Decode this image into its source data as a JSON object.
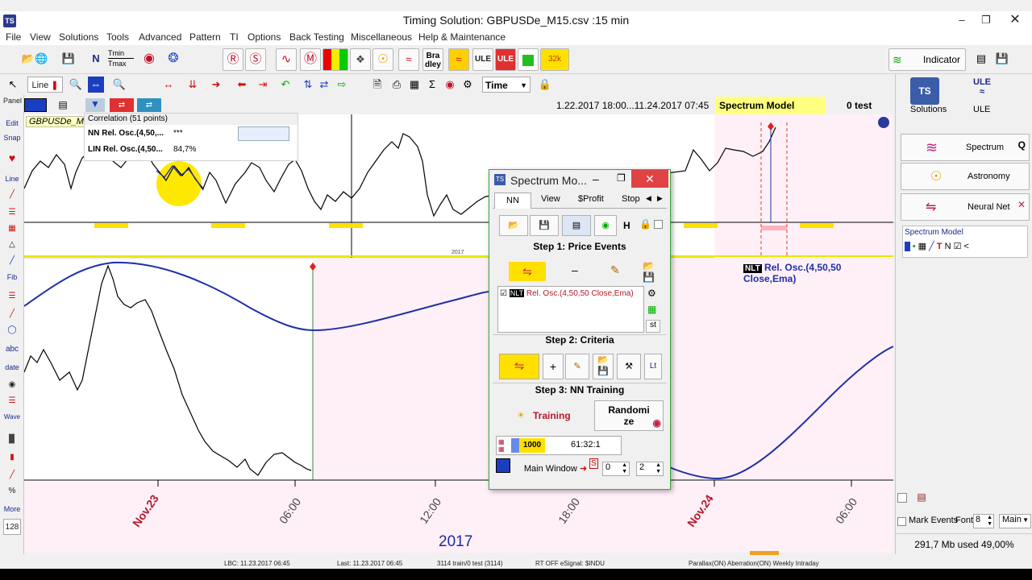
{
  "window": {
    "title": "Timing Solution:  GBPUSDe_M15.csv  :15 min",
    "app_icon": "TS"
  },
  "menu": [
    "File",
    "View",
    "Solutions",
    "Tools",
    "Advanced",
    "Pattern",
    "TI",
    "Options",
    "Back Testing",
    "Miscellaneous",
    "Help & Maintenance"
  ],
  "toolbar1": {
    "tmin_label": "Tmin",
    "tmax_label": "Tmax",
    "bradley_label": "Bra",
    "bradley_label2": "dley",
    "ule_label": "ULE",
    "ule2_label": "ULE",
    "badge_label": "32k",
    "indicator_label": "Indicator"
  },
  "toolbar2": {
    "line_label": "Line",
    "time_select": "Time"
  },
  "chartstrip": {
    "date_range": "1.22.2017  18:00...11.24.2017  07:45",
    "model_label": "Spectrum Model",
    "test_label": "0 test"
  },
  "chart_top": {
    "symbol_tab": "GBPUSDe_M",
    "correlation_title": "Correlation (51 points)",
    "rows": [
      {
        "name": "NN Rel. Osc.(4,50,...",
        "value": "***"
      },
      {
        "name": "LIN Rel. Osc.(4,50...",
        "value": "84,7%"
      }
    ],
    "axis_year": "2017"
  },
  "chart_bottom": {
    "legend_badge": "NLT",
    "legend_text": "Rel. Osc.(4,50,50 Close,Ema)",
    "x_labels": [
      "Nov.23",
      "06:00",
      "12:00",
      "18:00",
      "Nov.24",
      "06:00"
    ],
    "year": "2017"
  },
  "left_tools": [
    "Panel",
    "Edit",
    "Snap",
    "Line",
    "Fib",
    "abc",
    "date",
    "Wave",
    "%",
    "More",
    "128"
  ],
  "right_panel": {
    "solutions_label": "Solutions",
    "ule_label": "ULE",
    "spectrum_btn": "Spectrum",
    "spectrum_q": "Q",
    "astronomy_btn": "Astronomy",
    "neural_btn": "Neural Net",
    "model_title": "Spectrum Model",
    "model_n": "N",
    "mark_events": "Mark Events",
    "font_label": "Font",
    "font_size": "8",
    "main_select": "Main",
    "memory_text": "291,7 Mb used 49,00%"
  },
  "status": {
    "lbc": "LBC: 11.23.2017  06:45",
    "last": "Last: 11.23.2017  06:45",
    "train": "3114 train/0 test (3114)",
    "rt": "RT OFF eSignal: $INDU",
    "parallax": "Parallax(ON) Aberration(ON) Weekly Intraday"
  },
  "dialog": {
    "title": "Spectrum Mo...",
    "tabs": [
      "NN",
      "View",
      "$Profit",
      "Stop"
    ],
    "h_label": "H",
    "step1": "Step 1: Price Events",
    "event_badge": "NLT",
    "event_text": "Rel. Osc.(4,50,50 Close,Ema)",
    "st_label": "st",
    "step2": "Step 2: Criteria",
    "plus": "+",
    "lt_label": "Lt",
    "step3": "Step 3: NN Training",
    "training_btn": "Training",
    "randomize_1": "Randomi",
    "randomize_2": "ze",
    "counter": "1000",
    "timer": "61:32:1",
    "main_window_btn": "Main Window",
    "s_label": "S",
    "spin1": "0",
    "spin2": "2"
  },
  "colors": {
    "osc_blue": "#1f2fa8",
    "highlight_yellow": "#ffff99",
    "pink_zone": "#fff0f8",
    "dialog_border": "#3aa63a",
    "label_red": "#b11a2c"
  }
}
